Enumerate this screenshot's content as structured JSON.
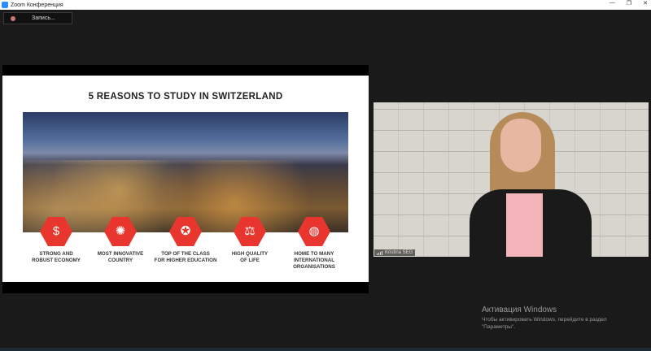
{
  "window": {
    "title": "Zoom Конференция",
    "minimize": "—",
    "maximize": "❐",
    "close": "✕"
  },
  "recording": {
    "label": "Запись..."
  },
  "slide": {
    "title": "5 REASONS TO STUDY IN SWITZERLAND",
    "reasons": [
      {
        "icon": "money-growth-icon",
        "glyph": "$",
        "label": "STRONG AND\nROBUST ECONOMY"
      },
      {
        "icon": "lightbulb-icon",
        "glyph": "✺",
        "label": "MOST INNOVATIVE\nCOUNTRY"
      },
      {
        "icon": "award-ribbon-icon",
        "glyph": "✪",
        "label": "TOP OF THE CLASS\nFOR HIGHER EDUCATION"
      },
      {
        "icon": "balance-scale-icon",
        "glyph": "⚖",
        "label": "HIGH QUALITY\nOF LIFE"
      },
      {
        "icon": "globe-icon",
        "glyph": "◍",
        "label": "HOME TO MANY\nINTERNATIONAL\nORGANISATIONS"
      }
    ]
  },
  "participant": {
    "name": "Kristina SEG"
  },
  "activation": {
    "heading": "Активация Windows",
    "text": "Чтобы активировать Windows, перейдите в раздел\n\"Параметры\"."
  }
}
